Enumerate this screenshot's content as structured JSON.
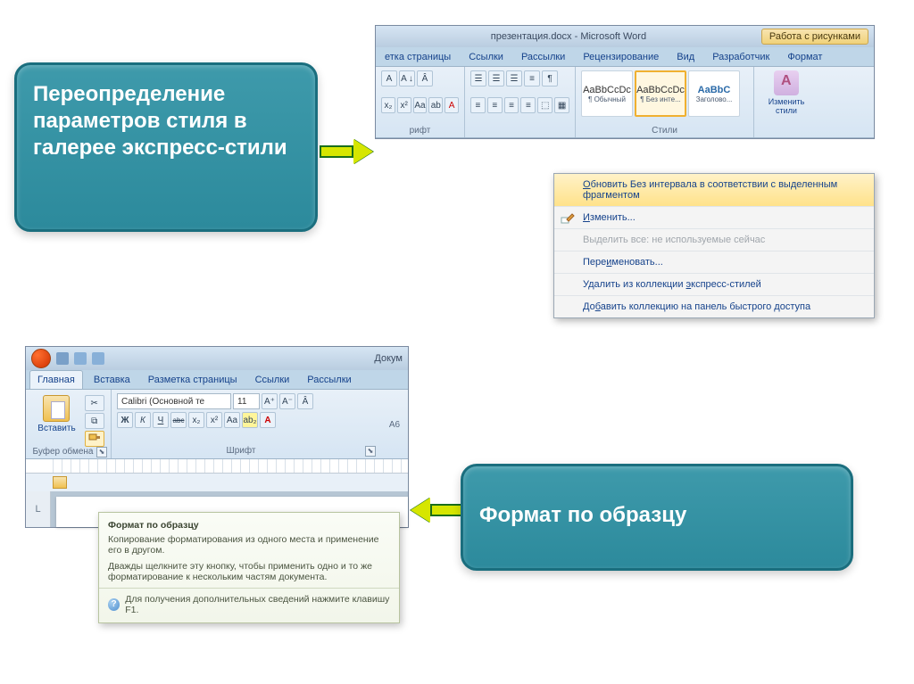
{
  "callouts": {
    "top": "Переопределение параметров стиля в галерее экспресс-стили",
    "bottom": "Формат по образцу"
  },
  "word_top": {
    "title": "презентация.docx - Microsoft Word",
    "tool_tab": "Работа с рисунками",
    "tabs": [
      "етка страницы",
      "Ссылки",
      "Рассылки",
      "Рецензирование",
      "Вид",
      "Разработчик",
      "Формат"
    ],
    "font_btns_r1": [
      "A",
      "A ↓",
      "Â"
    ],
    "font_btns_r2": [
      "x₂",
      "x²",
      "Aa",
      "ab",
      "A"
    ],
    "para_btns_r1": [
      "☰",
      "☰",
      "☰",
      "≡",
      "¶"
    ],
    "para_btns_r2": [
      "≡",
      "≡",
      "≡",
      "≡",
      "⬚",
      "▦"
    ],
    "styles": [
      {
        "preview": "AaBbCcDc",
        "name": "¶ Обычный"
      },
      {
        "preview": "AaBbCcDc",
        "name": "¶ Без инте..."
      },
      {
        "preview": "AaBbC",
        "name": "Заголово..."
      }
    ],
    "change_styles": "Изменить стили",
    "group_font": "рифт",
    "group_styles": "Стили",
    "context_menu": [
      "Обновить Без интервала в соответствии с выделенным фрагментом",
      "Изменить...",
      "Выделить все: не используемые сейчас",
      "Переименовать...",
      "Удалить из коллекции экспресс-стилей",
      "Добавить коллекцию на панель быстрого доступа"
    ]
  },
  "word_bl": {
    "title_right": "Докум",
    "tabs": [
      "Главная",
      "Вставка",
      "Разметка страницы",
      "Ссылки",
      "Рассылки"
    ],
    "paste": "Вставить",
    "clipboard_label": "Буфер обмена",
    "font_label": "Шрифт",
    "font_combo": "Calibri (Основной те",
    "size_combo": "11",
    "font_btns_r1": [
      "A⁺",
      "A⁻",
      "Â"
    ],
    "font_btns_r2": [
      "Ж",
      "К",
      "Ч",
      "abc",
      "x₂",
      "x²",
      "Aa",
      "ab₂",
      "A"
    ],
    "right_col": "А6"
  },
  "tooltip": {
    "title": "Формат по образцу",
    "line1": "Копирование форматирования из одного места и применение его в другом.",
    "line2": "Дважды щелкните эту кнопку, чтобы применить одно и то же форматирование к нескольким частям документа.",
    "help": "Для получения дополнительных сведений нажмите клавишу F1."
  }
}
